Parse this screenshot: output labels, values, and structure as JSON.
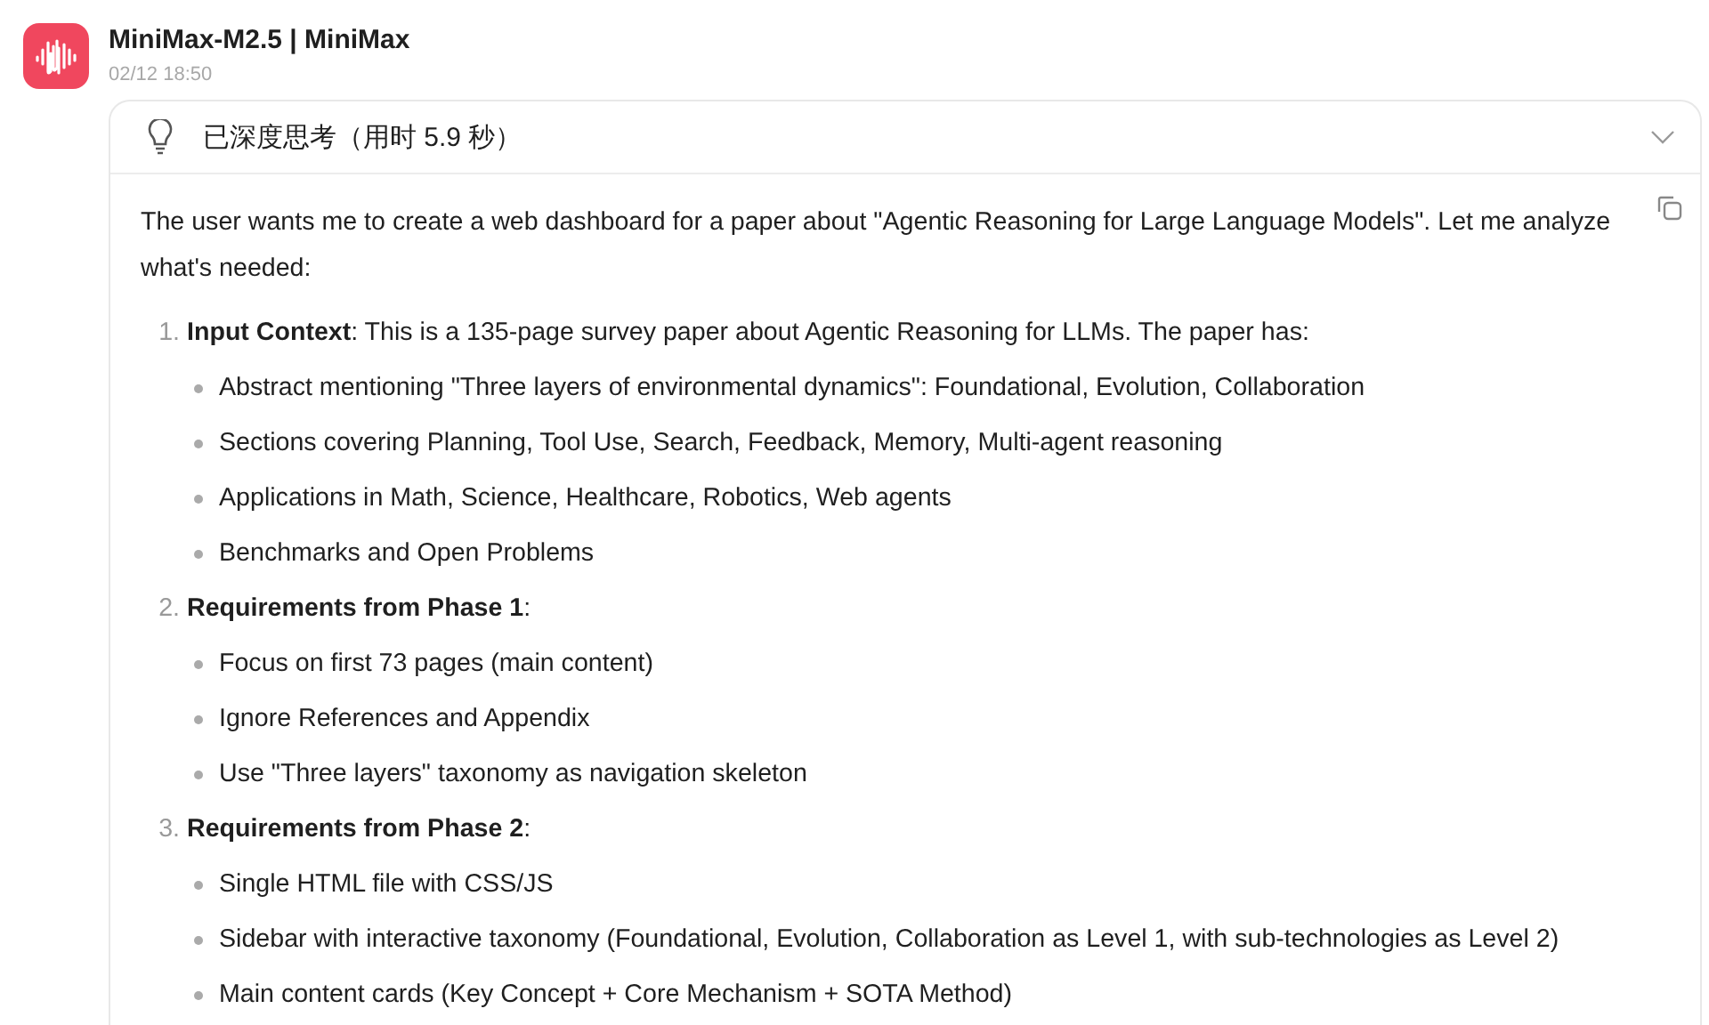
{
  "message": {
    "sender": "MiniMax-M2.5 | MiniMax",
    "time": "02/12 18:50"
  },
  "thinking": {
    "title": "已深度思考（用时 5.9 秒）",
    "expanded": true,
    "intro": "The user wants me to create a web dashboard for a paper about \"Agentic Reasoning for Large Language Models\". Let me analyze what's needed:",
    "items": [
      {
        "number": "1.",
        "text": "**Input Context**: This is a 135-page survey paper about Agentic Reasoning for LLMs. The paper has:",
        "bullets": [
          "Abstract mentioning \"Three layers of environmental dynamics\": Foundational, Evolution, Collaboration",
          "Sections covering Planning, Tool Use, Search, Feedback, Memory, Multi-agent reasoning",
          "Applications in Math, Science, Healthcare, Robotics, Web agents",
          "Benchmarks and Open Problems"
        ]
      },
      {
        "number": "2.",
        "text": "**Requirements from Phase 1**:",
        "bullets": [
          "Focus on first 73 pages (main content)",
          "Ignore References and Appendix",
          "Use \"Three layers\" taxonomy as navigation skeleton"
        ]
      },
      {
        "number": "3.",
        "text": "**Requirements from Phase 2**:",
        "bullets": [
          "Single HTML file with CSS/JS",
          "Sidebar with interactive taxonomy (Foundational, Evolution, Collaboration as Level 1, with sub-technologies as Level 2)",
          "Main content cards (Key Concept + Core Mechanism + SOTA Method)"
        ]
      }
    ]
  }
}
